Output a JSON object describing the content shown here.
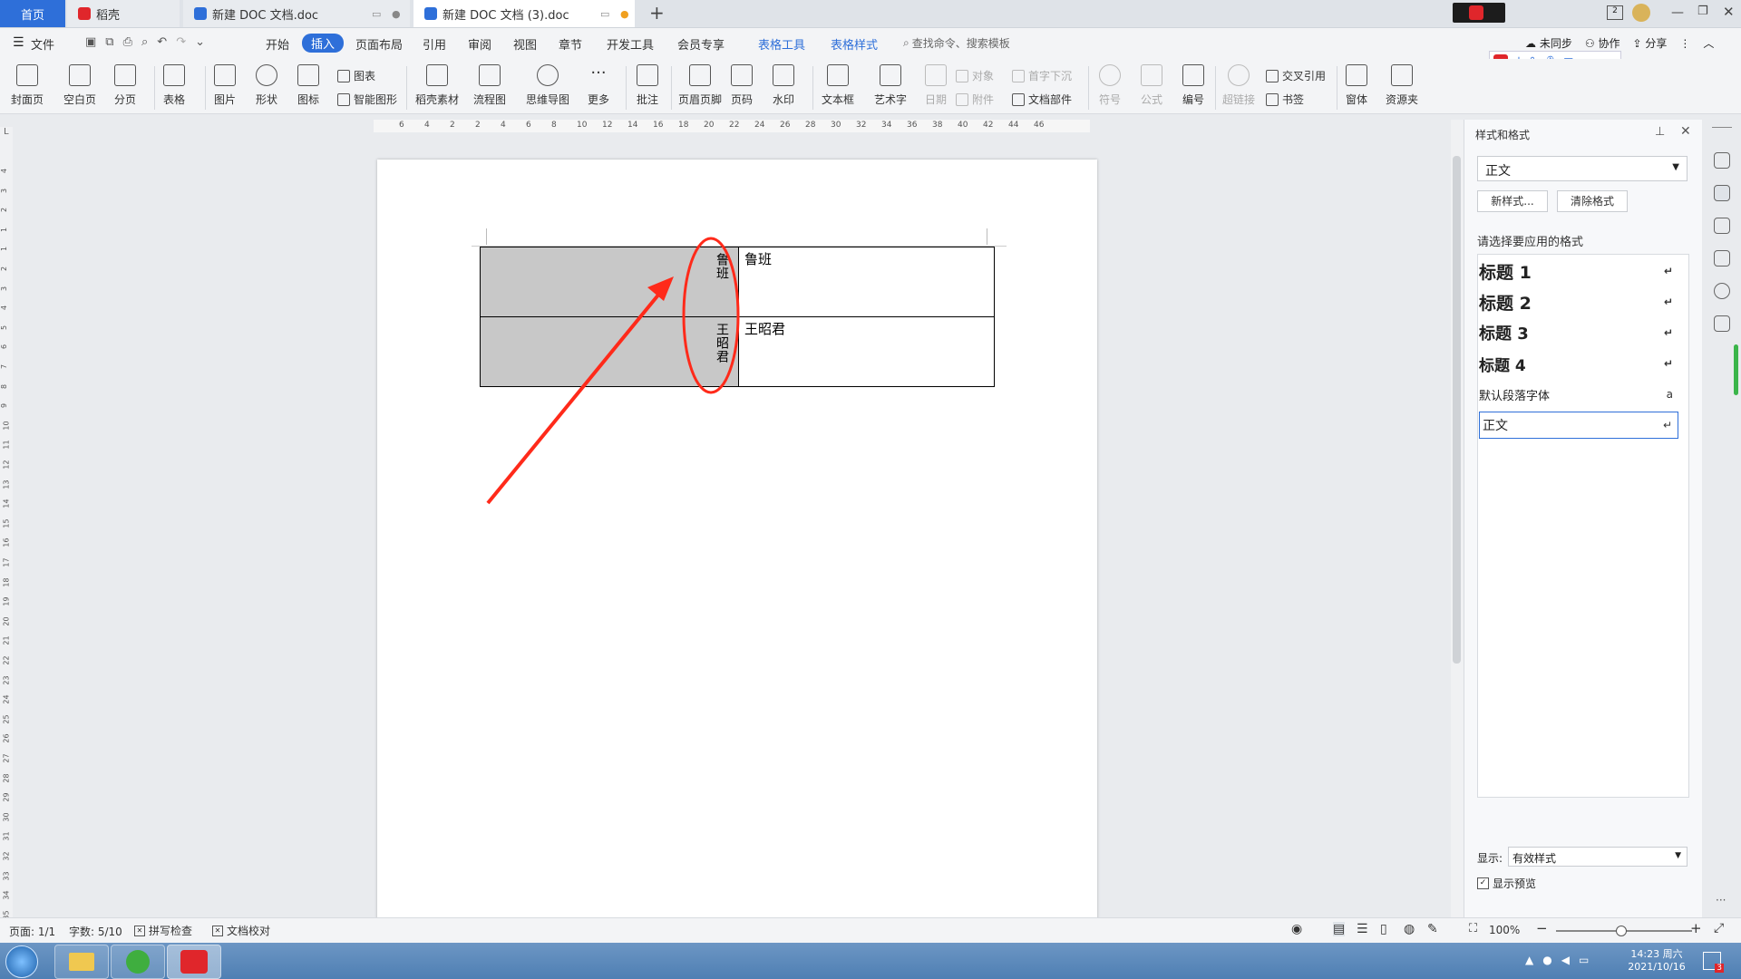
{
  "tabs": {
    "home": "首页",
    "items": [
      {
        "label": "稻壳",
        "icon": "daoke-icon"
      },
      {
        "label": "新建 DOC 文档.doc",
        "icon": "wps-doc-icon"
      },
      {
        "label": "新建 DOC 文档 (3).doc",
        "icon": "wps-doc-icon"
      }
    ],
    "new_tab": "+"
  },
  "menubar": {
    "file": "文件",
    "items": [
      "开始",
      "插入",
      "页面布局",
      "引用",
      "审阅",
      "视图",
      "章节",
      "开发工具",
      "会员专享"
    ],
    "context_tabs": [
      "表格工具",
      "表格样式"
    ],
    "search_placeholder": "查找命令、搜索模板",
    "right": {
      "sync": "未同步",
      "collab": "协作",
      "share": "分享"
    }
  },
  "ribbon": {
    "cover": "封面页",
    "blank": "空白页",
    "pagebreak": "分页",
    "table": "表格",
    "picture": "图片",
    "shape": "形状",
    "icon": "图标",
    "chart": "图表",
    "smartart": "智能图形",
    "daoke": "稻壳素材",
    "flow": "流程图",
    "mindmap": "思维导图",
    "more": "更多",
    "comment": "批注",
    "header": "页眉页脚",
    "pagenum": "页码",
    "watermark": "水印",
    "textbox": "文本框",
    "wordart": "艺术字",
    "date": "日期",
    "object": "对象",
    "attach": "附件",
    "dropcap": "首字下沉",
    "docpart": "文档部件",
    "symbol": "符号",
    "formula": "公式",
    "numbering": "编号",
    "hyperlink": "超链接",
    "crossref": "交叉引用",
    "bookmark": "书签",
    "window": "窗体",
    "resources": "资源夹"
  },
  "ruler": {
    "h_ticks": [
      "6",
      "4",
      "2",
      "2",
      "4",
      "6",
      "8",
      "10",
      "12",
      "14",
      "16",
      "18",
      "20",
      "22",
      "24",
      "26",
      "28",
      "30",
      "32",
      "34",
      "36",
      "38",
      "40",
      "42",
      "44",
      "46"
    ],
    "v_ticks": [
      "4",
      "3",
      "2",
      "1",
      "1",
      "2",
      "3",
      "4",
      "5",
      "6",
      "7",
      "8",
      "9",
      "10",
      "11",
      "12",
      "13",
      "14",
      "15",
      "16",
      "17",
      "18",
      "19",
      "20",
      "21",
      "22",
      "23",
      "24",
      "25",
      "26",
      "27",
      "28",
      "29",
      "30",
      "31",
      "32",
      "33",
      "34",
      "35"
    ]
  },
  "document": {
    "rows": [
      {
        "vertical": "鲁班",
        "text": "鲁班"
      },
      {
        "vertical": "王昭君",
        "text": "王昭君"
      }
    ]
  },
  "panel": {
    "title": "样式和格式",
    "current_style": "正文",
    "new_style": "新样式...",
    "clear_format": "清除格式",
    "prompt": "请选择要应用的格式",
    "styles": [
      "标题 1",
      "标题 2",
      "标题 3",
      "标题 4",
      "默认段落字体",
      "正文"
    ],
    "show_label": "显示:",
    "show_value": "有效样式",
    "preview": "显示预览"
  },
  "status": {
    "page": "页面: 1/1",
    "words": "字数: 5/10",
    "spell": "拼写检查",
    "proof": "文档校对",
    "zoom": "100%"
  },
  "taskbar": {
    "time": "14:23 周六",
    "date": "2021/10/16",
    "badge": "3"
  },
  "colors": {
    "accent": "#2e6fd9",
    "annotation": "#ff2a1a",
    "wps_red": "#e0262b"
  }
}
